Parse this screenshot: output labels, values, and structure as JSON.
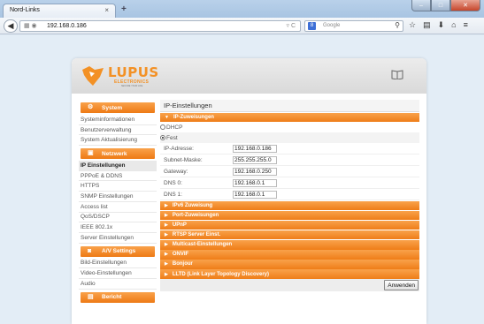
{
  "browser": {
    "tab_title": "Nord-Links",
    "tab_close": "×",
    "new_tab": "+",
    "url": "192.168.0.186",
    "search_placeholder": "Google",
    "search_engine_label": "8",
    "window_buttons": [
      "–",
      "□",
      "✕"
    ]
  },
  "brand": {
    "name": "LUPUS",
    "subtitle": "ELECTRONICS",
    "tagline": "SECURE YOUR LIFE",
    "accent": "#f39125"
  },
  "sidebar": {
    "groups": [
      {
        "title": "System",
        "icon": "gear-icon",
        "items": [
          "Systeminformationen",
          "Benutzerverwaltung",
          "System Aktualisierung"
        ]
      },
      {
        "title": "Netzwerk",
        "icon": "network-icon",
        "items": [
          "IP Einstellungen",
          "PPPoE & DDNS",
          "HTTPS",
          "SNMP Einstellungen",
          "Access list",
          "QoS/DSCP",
          "IEEE 802.1x",
          "Server Einstellungen"
        ]
      },
      {
        "title": "A/V Settings",
        "icon": "camera-icon",
        "items": [
          "Bild-Einstellungen",
          "Video-Einstellungen",
          "Audio"
        ]
      },
      {
        "title": "Bericht",
        "icon": "report-icon",
        "items": []
      }
    ],
    "active_item": "IP Einstellungen"
  },
  "main": {
    "title": "IP-Einstellungen",
    "section_open": "IP-Zuweisungen",
    "radio_dhcp": "DHCP",
    "radio_fest": "Fest",
    "selected_mode": "Fest",
    "fields": [
      {
        "label": "IP-Adresse:",
        "value": "192.168.0.186"
      },
      {
        "label": "Subnet-Maske:",
        "value": "255.255.255.0"
      },
      {
        "label": "Gateway:",
        "value": "192.168.0.250"
      },
      {
        "label": "DNS 0:",
        "value": "192.168.0.1"
      },
      {
        "label": "DNS 1:",
        "value": "192.168.0.1"
      }
    ],
    "collapsed_sections": [
      "IPv6 Zuweisung",
      "Port-Zuweisungen",
      "UPnP",
      "RTSP Server Einst.",
      "Multicast-Einstellungen",
      "ONVIF",
      "Bonjour",
      "LLTD (Link Layer Topology Discovery)"
    ],
    "apply_label": "Anwenden"
  }
}
